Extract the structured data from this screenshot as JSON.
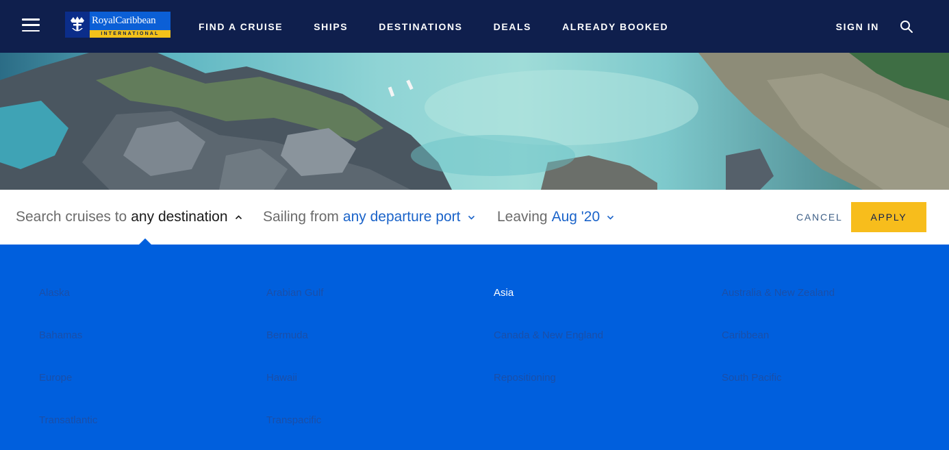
{
  "header": {
    "logo": {
      "brand_top": "RoyalCaribbean",
      "brand_bottom": "INTERNATIONAL"
    },
    "nav": [
      {
        "label": "FIND A CRUISE"
      },
      {
        "label": "SHIPS"
      },
      {
        "label": "DESTINATIONS"
      },
      {
        "label": "DEALS"
      },
      {
        "label": "ALREADY BOOKED"
      }
    ],
    "sign_in": "SIGN IN"
  },
  "search": {
    "destination": {
      "label": "Search cruises to",
      "value": "any destination"
    },
    "port": {
      "label": "Sailing from",
      "value": "any departure port"
    },
    "leaving": {
      "label": "Leaving",
      "value": "Aug '20"
    },
    "cancel": "CANCEL",
    "apply": "APPLY"
  },
  "destinations": [
    {
      "label": "Alaska",
      "selected": false
    },
    {
      "label": "Arabian Gulf",
      "selected": false
    },
    {
      "label": "Asia",
      "selected": true
    },
    {
      "label": "Australia & New Zealand",
      "selected": false
    },
    {
      "label": "Bahamas",
      "selected": false
    },
    {
      "label": "Bermuda",
      "selected": false
    },
    {
      "label": "Canada & New England",
      "selected": false
    },
    {
      "label": "Caribbean",
      "selected": false
    },
    {
      "label": "Europe",
      "selected": false
    },
    {
      "label": "Hawaii",
      "selected": false
    },
    {
      "label": "Repositioning",
      "selected": false
    },
    {
      "label": "South Pacific",
      "selected": false
    },
    {
      "label": "Transatlantic",
      "selected": false
    },
    {
      "label": "Transpacific",
      "selected": false
    }
  ],
  "colors": {
    "nav_bg": "#0f1f4d",
    "panel_bg": "#005fdd",
    "apply_bg": "#f7bd1c",
    "link_blue": "#1a63c9"
  }
}
